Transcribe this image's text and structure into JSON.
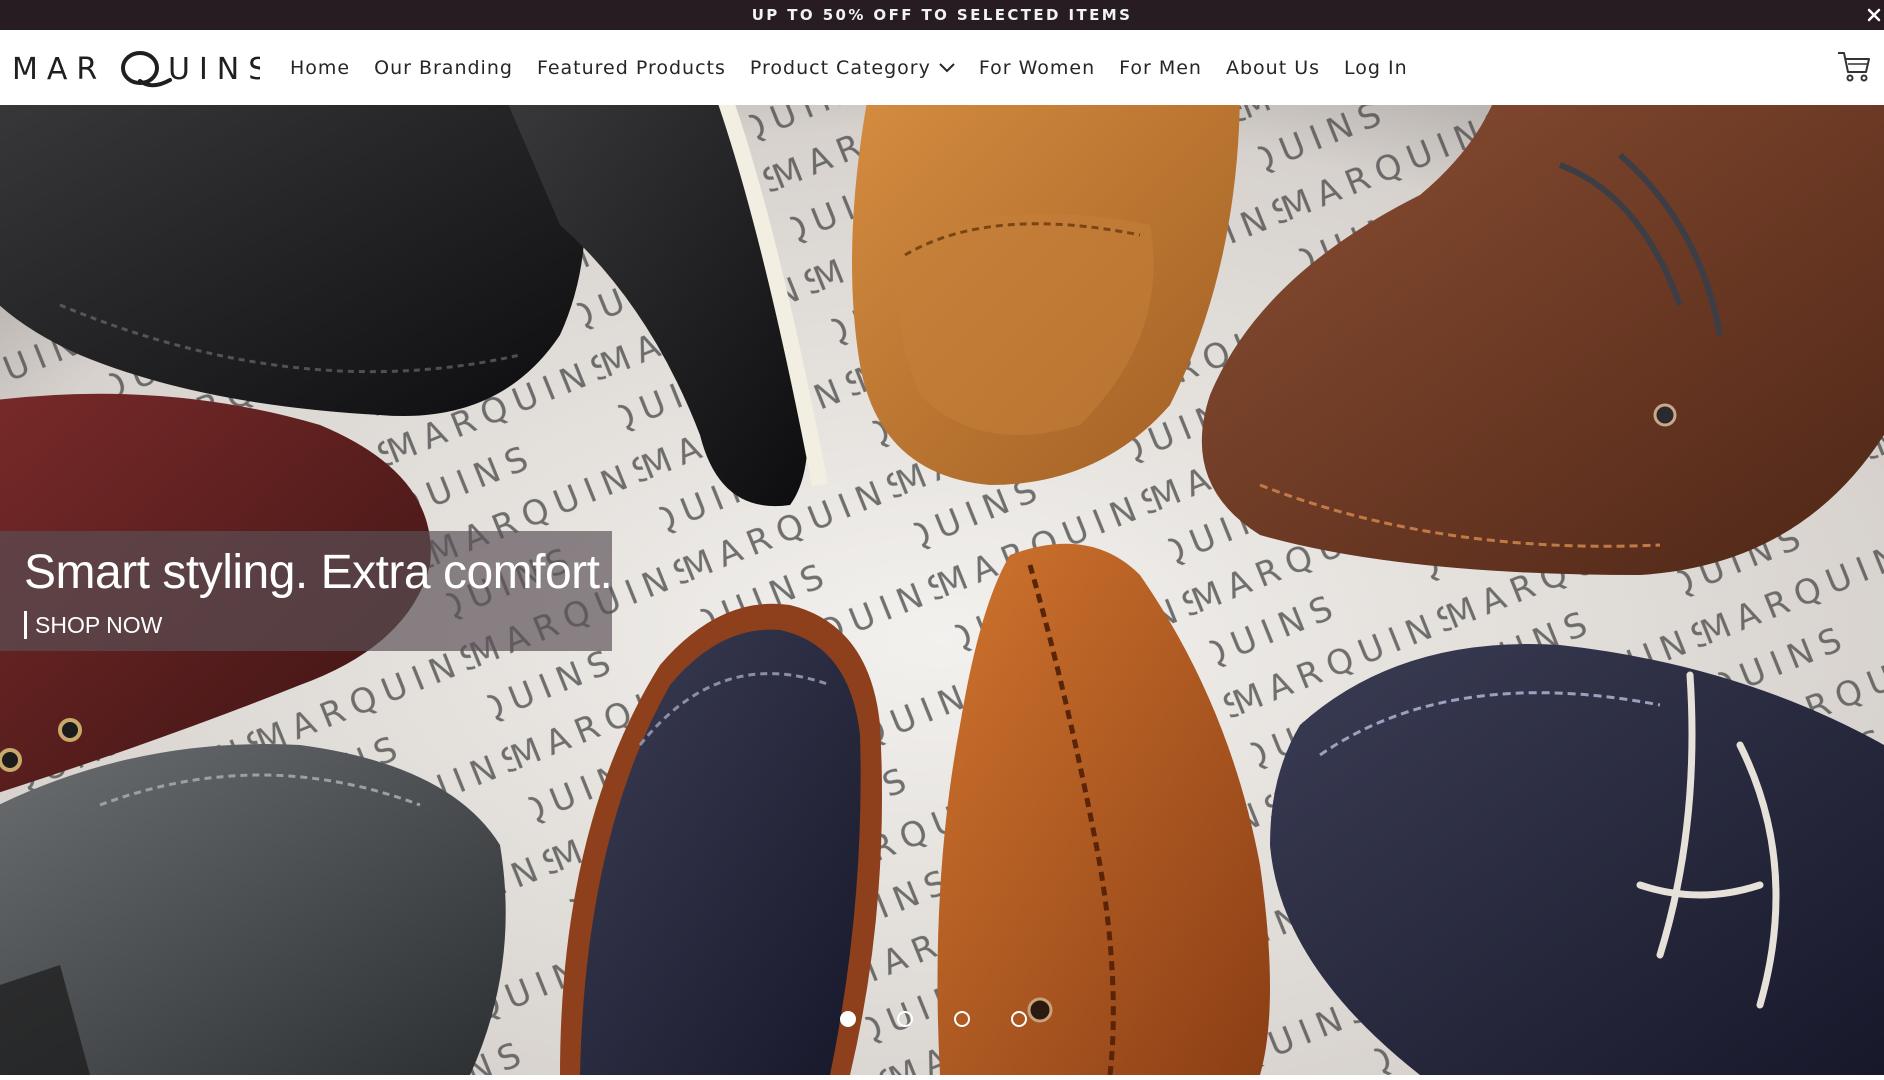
{
  "announcement": {
    "text": "UP TO 50% OFF TO SELECTED ITEMS",
    "close_icon": "close-icon"
  },
  "header": {
    "logo_text": "MARQUINS",
    "nav": [
      {
        "label": "Home"
      },
      {
        "label": "Our Branding"
      },
      {
        "label": "Featured Products"
      },
      {
        "label": "Product Category",
        "icon": "chevron-down-icon"
      },
      {
        "label": "For Women"
      },
      {
        "label": "For Men"
      },
      {
        "label": "About Us"
      },
      {
        "label": "Log In"
      }
    ],
    "cart_icon": "cart-icon"
  },
  "hero": {
    "headline": "Smart styling. Extra comfort.",
    "cta": "SHOP NOW",
    "background_text": "MARQUINS",
    "slide_dots": 4,
    "active_slide": 1
  },
  "colors": {
    "announcement_bg": "#261c22",
    "caption_bg": "#5a5055",
    "text_dark": "#262626"
  }
}
